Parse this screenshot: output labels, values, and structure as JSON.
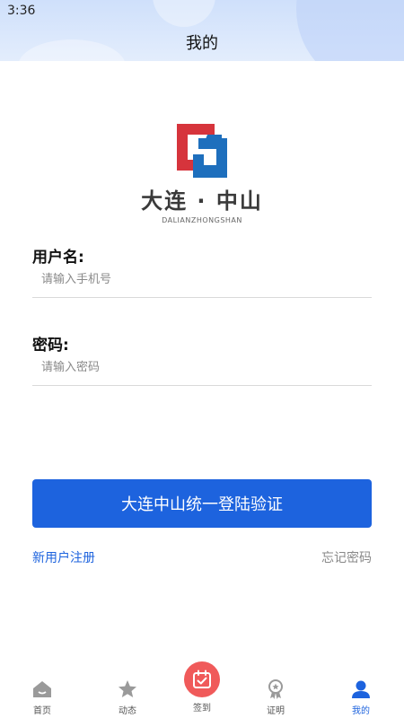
{
  "status_bar": {
    "time": "3:36"
  },
  "header": {
    "title": "我的"
  },
  "logo": {
    "name": "大连 · 中山",
    "subtitle": "DALIANZHONGSHAN",
    "colors": {
      "red": "#d6343c",
      "blue": "#1e6fbd"
    }
  },
  "form": {
    "username_label": "用户名:",
    "username_placeholder": "请输入手机号",
    "username_value": "",
    "password_label": "密码:",
    "password_placeholder": "请输入密码",
    "password_value": ""
  },
  "actions": {
    "login_label": "大连中山统一登陆验证",
    "register_label": "新用户注册",
    "forgot_label": "忘记密码"
  },
  "tabbar": {
    "items": [
      {
        "label": "首页",
        "icon": "home-icon"
      },
      {
        "label": "动态",
        "icon": "star-icon"
      },
      {
        "label": "签到",
        "icon": "calendar-check-icon"
      },
      {
        "label": "证明",
        "icon": "award-icon"
      },
      {
        "label": "我的",
        "icon": "user-icon",
        "active": true
      }
    ]
  },
  "colors": {
    "primary": "#1d63de",
    "checkin": "#f05a5a",
    "inactive": "#9a9a9a"
  }
}
